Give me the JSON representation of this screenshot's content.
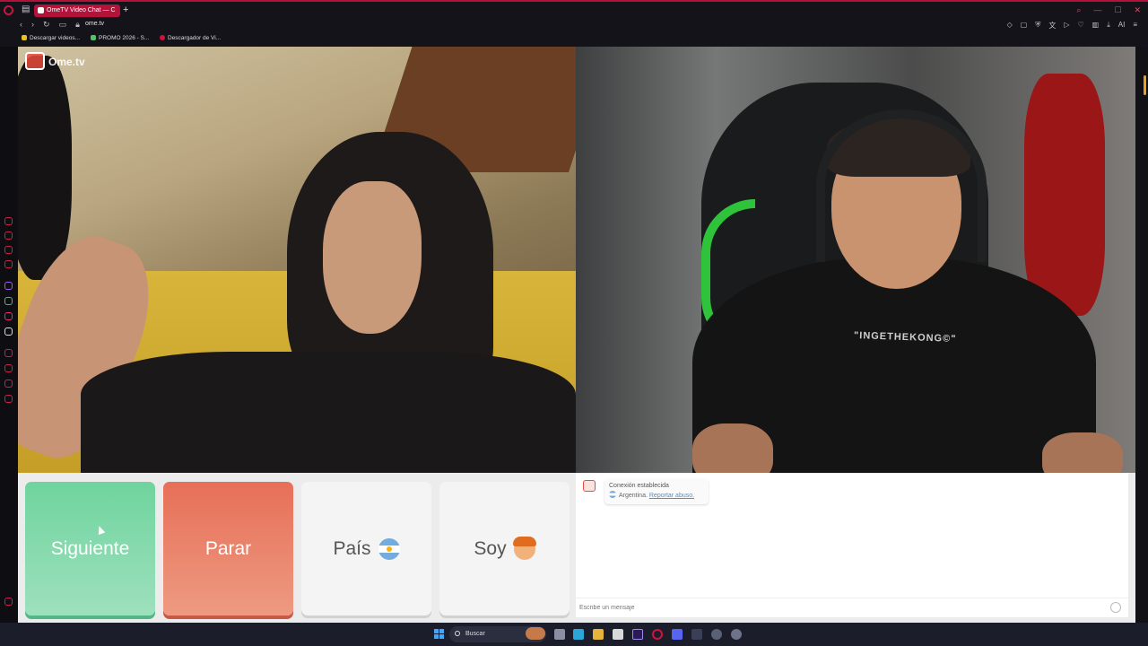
{
  "browser": {
    "tab_title": "OmeTV Video Chat — C",
    "new_tab": "+",
    "url": "ome.tv",
    "ai_label": "AI",
    "bookmarks": [
      "Descargar videos...",
      "PROMO 2026 - S...",
      "Descargador de Vi..."
    ]
  },
  "page": {
    "logo_text": "Ome.tv",
    "shirt_text": "\"INGETHEKONG©\"",
    "buttons": {
      "next": "Siguiente",
      "stop": "Parar",
      "country": "País",
      "gender": "Soy"
    },
    "chat": {
      "status": "Conexión establecida",
      "country": "Argentina.",
      "report_link": "Reportar abuso.",
      "input_placeholder": "Escribe un mensaje"
    }
  },
  "taskbar": {
    "search_label": "Buscar"
  },
  "colors": {
    "next": "#6fd49e",
    "stop": "#e76f57",
    "accent": "#b3123a"
  }
}
